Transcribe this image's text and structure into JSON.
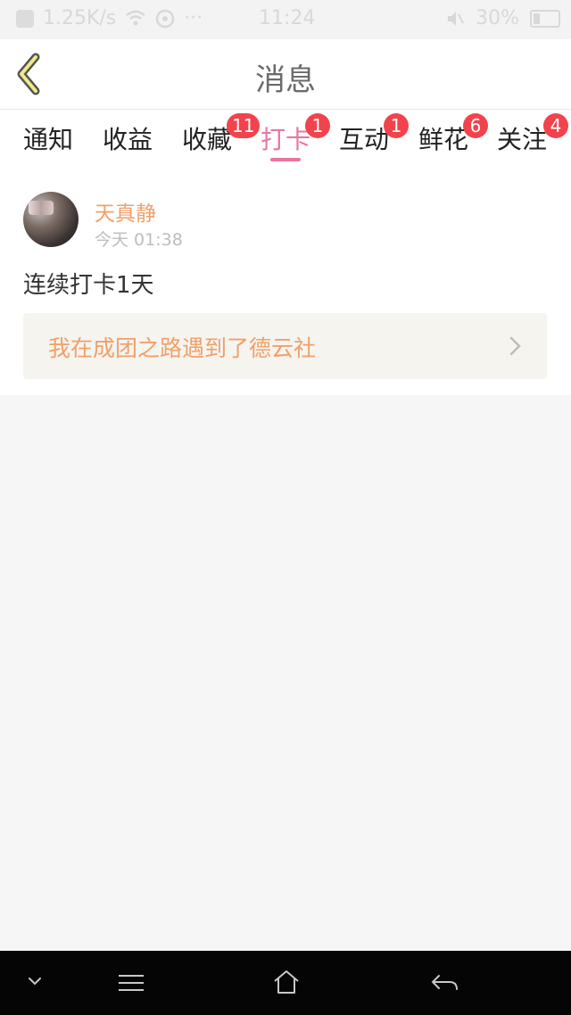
{
  "status_bar": {
    "speed": "1.25K/s",
    "dots": "···",
    "time": "11:24",
    "battery": "30%"
  },
  "header": {
    "title": "消息"
  },
  "tabs": [
    {
      "label": "通知",
      "badge": ""
    },
    {
      "label": "收益",
      "badge": ""
    },
    {
      "label": "收藏",
      "badge": "11"
    },
    {
      "label": "打卡",
      "badge": "1"
    },
    {
      "label": "互动",
      "badge": "1"
    },
    {
      "label": "鲜花",
      "badge": "6"
    },
    {
      "label": "关注",
      "badge": "4"
    }
  ],
  "active_tab": "打卡",
  "post": {
    "author": "天真静",
    "time": "今天 01:38",
    "text": "连续打卡1天",
    "link_text": "我在成团之路遇到了德云社"
  },
  "colors": {
    "accent_pink": "#e775a2",
    "author_orange": "#f0a06a",
    "badge_red": "#f2434c"
  },
  "icons": {
    "back": "back-arrow-icon",
    "chevron": "chevron-right-icon",
    "nav": [
      "chevron-down-icon",
      "menu-icon",
      "home-icon",
      "back-icon"
    ]
  }
}
